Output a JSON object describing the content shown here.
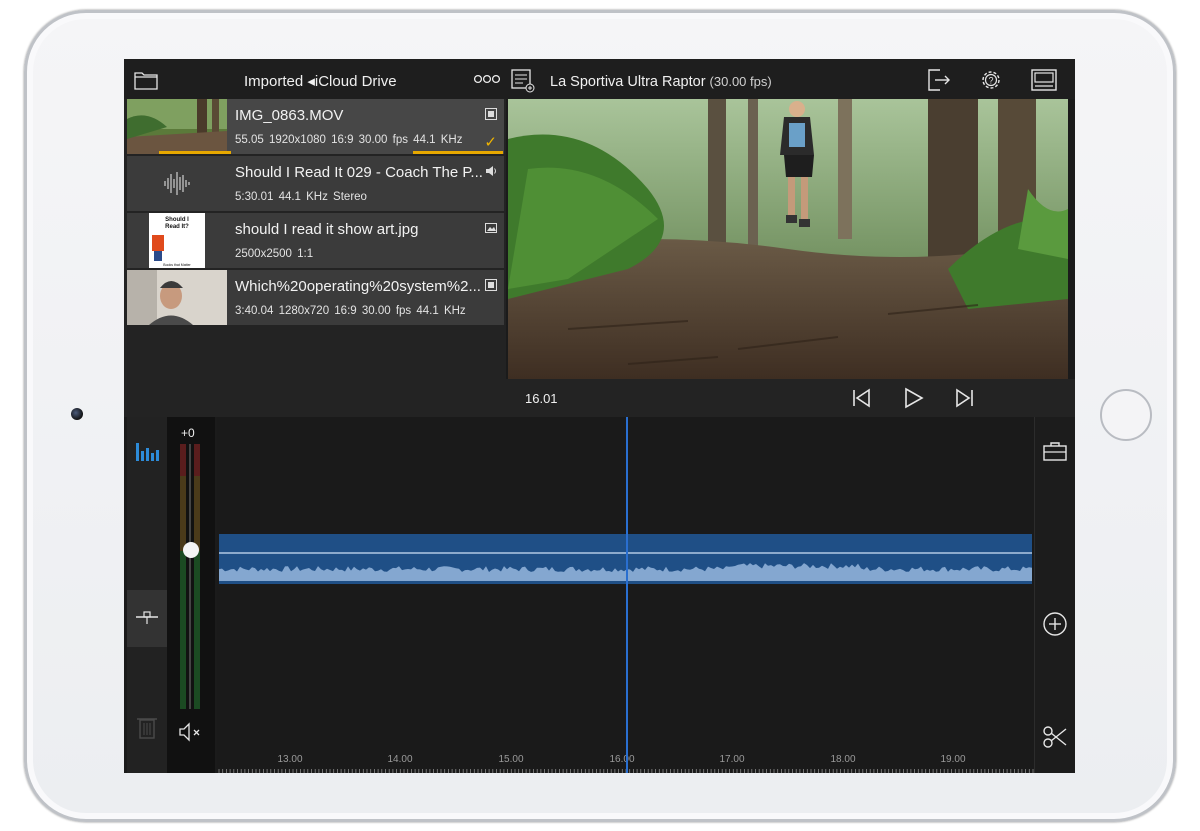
{
  "browser": {
    "title": "Imported ◂iCloud Drive",
    "items": [
      {
        "name": "IMG_0863.MOV",
        "meta": "55.05  1920x1080  16:9  30.00 fps  44.1 KHz",
        "type": "video",
        "selected": true,
        "progress": 0.4
      },
      {
        "name": "Should I Read It 029 - Coach The P...",
        "meta": "5:30.01  44.1 KHz  Stereo",
        "type": "audio",
        "selected": false
      },
      {
        "name": "should I read it show art.jpg",
        "meta": "2500x2500  1:1",
        "type": "image",
        "selected": false,
        "art_lines": [
          "Should I",
          "Read It?",
          "Books that Matter"
        ]
      },
      {
        "name": "Which%20operating%20system%2...",
        "meta": "3:40.04  1280x720  16:9  30.00 fps  44.1 KHz",
        "type": "video",
        "selected": false
      }
    ]
  },
  "viewer": {
    "project_title": "La Sportiva Ultra Raptor",
    "project_fps": "(30.00 fps)",
    "timecode": "16.01"
  },
  "meter": {
    "value": "+0",
    "level": 0.6
  },
  "timeline": {
    "ruler_labels": [
      "13.00",
      "14.00",
      "15.00",
      "16.00",
      "17.00",
      "18.00",
      "19.00"
    ]
  },
  "colors": {
    "accent": "#e7a800",
    "clip": "#1f4f86",
    "playhead": "#2a6fd0",
    "meter_active": "#2d8bd8"
  }
}
